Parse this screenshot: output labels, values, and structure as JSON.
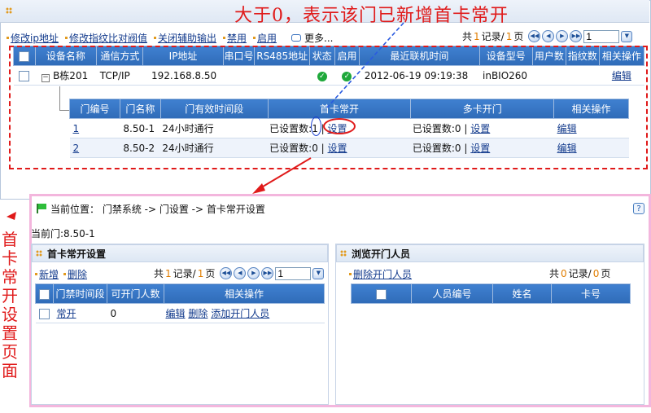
{
  "annotation": {
    "title": "大于0，表示该门已新增首卡常开",
    "side_text": "首卡常开设置页面"
  },
  "toolbar": {
    "items": [
      "修改ip地址",
      "修改指纹比对阀值",
      "关闭辅助输出",
      "禁用",
      "启用"
    ],
    "more": "更多..."
  },
  "pager_top": {
    "pre": "共",
    "count": "1",
    "records": "记录/",
    "pages": "1",
    "page_word": "页",
    "current": "1"
  },
  "device_table": {
    "headers": [
      "设备名称",
      "通信方式",
      "IP地址",
      "串口号",
      "RS485地址",
      "状态",
      "启用",
      "最近联机时间",
      "设备型号",
      "用户数",
      "指纹数",
      "相关操作"
    ],
    "row": {
      "name": "B栋201",
      "comm": "TCP/IP",
      "ip": "192.168.8.50",
      "serial": "",
      "rs485": "",
      "last_online": "2012-06-19 09:19:38",
      "model": "inBIO260",
      "users": "",
      "fingerprints": "",
      "action": "编辑"
    }
  },
  "door_table": {
    "headers": [
      "门编号",
      "门名称",
      "门有效时间段",
      "首卡常开",
      "多卡开门",
      "相关操作"
    ],
    "rows": [
      {
        "no": "1",
        "name": "8.50-1",
        "period": "24小时通行",
        "first_card_label": "已设置数:",
        "first_card_count": "1",
        "first_card_set": "设置",
        "multi_label": "已设置数:0",
        "multi_set": "设置",
        "action": "编辑"
      },
      {
        "no": "2",
        "name": "8.50-2",
        "period": "24小时通行",
        "first_card_label": "已设置数:",
        "first_card_count": "0",
        "first_card_set": "设置",
        "multi_label": "已设置数:0",
        "multi_set": "设置",
        "action": "编辑"
      }
    ]
  },
  "bottom": {
    "breadcrumb": "当前位置： 门禁系统 -> 门设置 -> 首卡常开设置",
    "current_door": "当前门:8.50-1",
    "left_panel": {
      "title": "首卡常开设置",
      "add": "新增",
      "delete": "删除",
      "pager": {
        "pre": "共",
        "count": "1",
        "records": "记录/",
        "pages": "1",
        "page_word": "页",
        "current": "1"
      },
      "headers": [
        "门禁时间段",
        "可开门人数",
        "相关操作"
      ],
      "row": {
        "period": "常开",
        "count": "0",
        "edit": "编辑",
        "delete": "删除",
        "add_person": "添加开门人员"
      }
    },
    "right_panel": {
      "title": "浏览开门人员",
      "delete": "删除开门人员",
      "pager": {
        "pre": "共",
        "count": "0",
        "records": "记录/",
        "pages": "0",
        "page_word": "页"
      },
      "headers": [
        "人员编号",
        "姓名",
        "卡号"
      ]
    }
  },
  "colors": {
    "accent_red": "#e01a1a",
    "header_blue": "#2f6bb8",
    "pink_frame": "#f3b6dd"
  }
}
